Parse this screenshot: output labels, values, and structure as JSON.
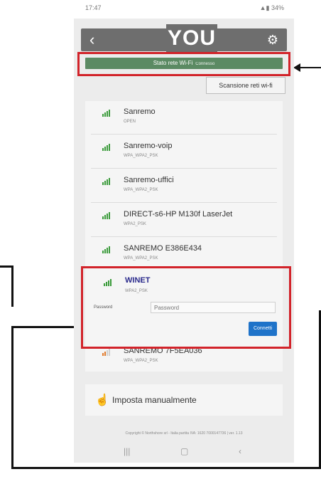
{
  "statusbar": {
    "time": "17:47",
    "battery": "34%"
  },
  "appbar": {
    "logo": "YOU"
  },
  "wifi_state": {
    "label": "Stato rete Wi-Fi",
    "status": "Connesso"
  },
  "scan_button": "Scansione reti wi-fi",
  "networks": [
    {
      "name": "Sanremo",
      "security": "OPEN"
    },
    {
      "name": "Sanremo-voip",
      "security": "WPA_WPA2_PSK"
    },
    {
      "name": "Sanremo-uffici",
      "security": "WPA_WPA2_PSK"
    },
    {
      "name": "DIRECT-s6-HP M130f LaserJet",
      "security": "WPA2_PSK"
    },
    {
      "name": "SANREMO E386E434",
      "security": "WPA_WPA2_PSK"
    },
    {
      "name": "WINET",
      "security": "WPA2_PSK"
    },
    {
      "name": "SANREMO 7F5EA036",
      "security": "WPA_WPA2_PSK"
    }
  ],
  "password": {
    "label": "Password",
    "placeholder": "Password"
  },
  "connect_button": "Connetti",
  "manual": "Imposta manualmente",
  "footer": "Copyright © Northshore srl - Italia partita IVA: 1620 7000147736 | ver. 1.13",
  "colors": {
    "accent": "#1f73c9",
    "state_bar": "#5b8a63",
    "highlight": "#d2232a",
    "signal": "#3b9b3b",
    "signal_weak": "#e07a2b"
  }
}
